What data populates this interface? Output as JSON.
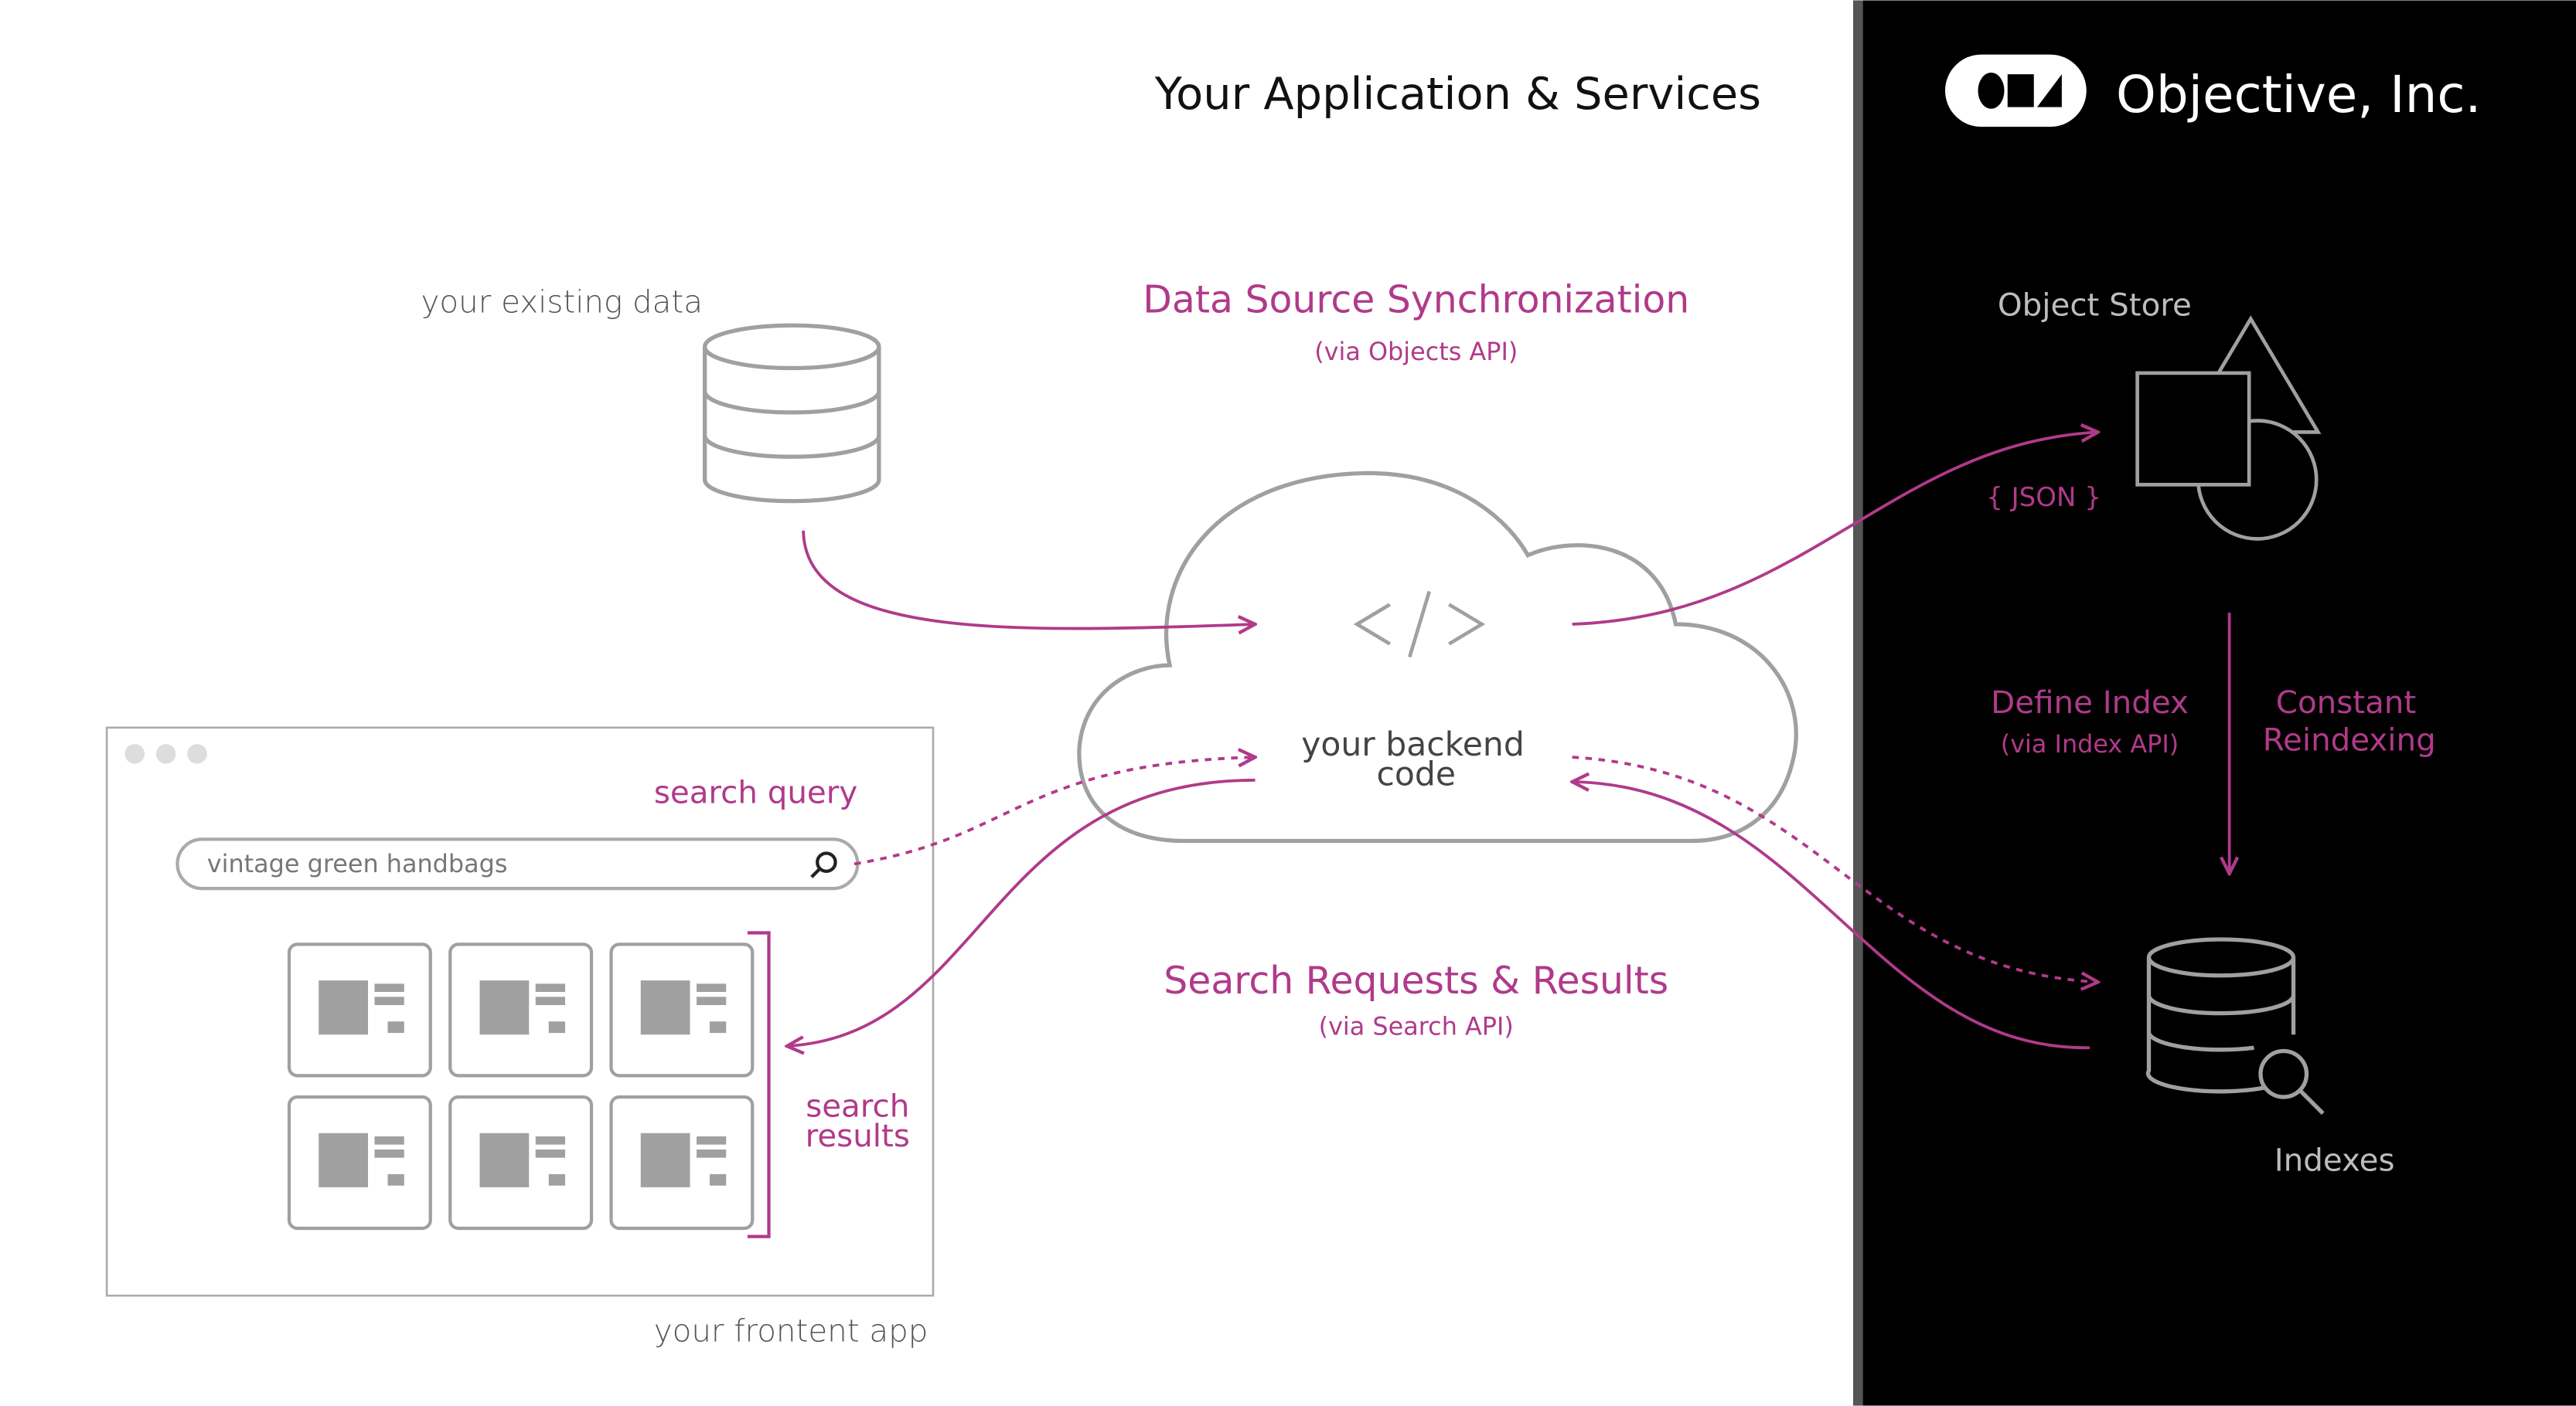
{
  "header": {
    "left_title": "Your Application & Services",
    "brand_name": "Objective, Inc.",
    "brand_logo_text": "Objective, Inc."
  },
  "labels": {
    "existing_data": "your existing data",
    "sync_title": "Data Source Synchronization",
    "sync_sub": "(via Objects API)",
    "backend_line1": "your backend",
    "backend_line2": "code",
    "search_title": "Search Requests & Results",
    "search_sub": "(via Search API)",
    "frontend_app": "your frontent app",
    "search_query": "search query",
    "search_results_line1": "search",
    "search_results_line2": "results",
    "object_store": "Object Store",
    "json": "{ JSON }",
    "define_index": "Define Index",
    "define_index_sub": "(via Index API)",
    "reindex_line1": "Constant",
    "reindex_line2": "Reindexing",
    "indexes": "Indexes"
  },
  "search_input": {
    "value": "vintage green handbags"
  },
  "colors": {
    "accent": "#b03a8a",
    "icon_gray": "#a0a0a0",
    "dark_panel": "#000000"
  },
  "icons": [
    "database-icon",
    "cloud-icon",
    "code-icon",
    "search-icon",
    "object-shapes-icon",
    "index-database-icon",
    "brand-logo-icon"
  ]
}
